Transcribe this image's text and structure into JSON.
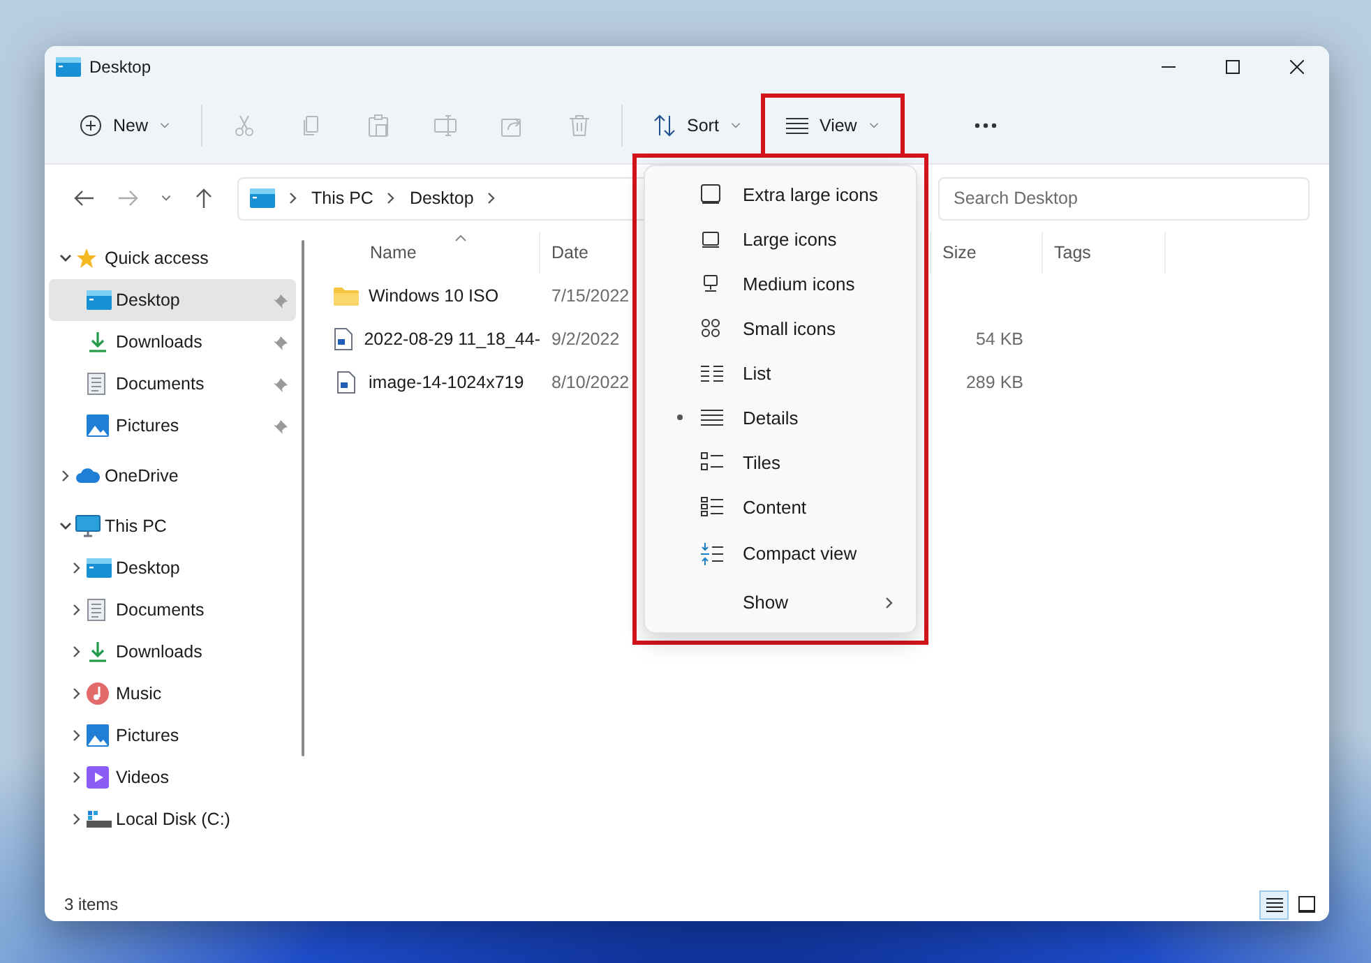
{
  "window": {
    "title": "Desktop"
  },
  "toolbar": {
    "items": [
      {
        "kind": "new",
        "label": "New",
        "disabled": false
      },
      {
        "kind": "cut",
        "disabled": true
      },
      {
        "kind": "copy",
        "disabled": true
      },
      {
        "kind": "paste",
        "disabled": true
      },
      {
        "kind": "rename",
        "disabled": true
      },
      {
        "kind": "share",
        "disabled": true
      },
      {
        "kind": "delete",
        "disabled": true
      },
      {
        "kind": "sort",
        "label": "Sort",
        "disabled": false
      },
      {
        "kind": "view",
        "label": "View",
        "disabled": false,
        "highlighted": true
      },
      {
        "kind": "more",
        "disabled": false
      }
    ]
  },
  "address": {
    "breadcrumbs": [
      "This PC",
      "Desktop"
    ]
  },
  "search": {
    "placeholder": "Search Desktop"
  },
  "nav": {
    "items": [
      {
        "label": "Quick access",
        "kind": "star",
        "expanded": true,
        "selected": false,
        "children": [
          {
            "label": "Desktop",
            "kind": "desktop",
            "selected": true,
            "pinned": true
          },
          {
            "label": "Downloads",
            "kind": "downloads",
            "selected": false,
            "pinned": true
          },
          {
            "label": "Documents",
            "kind": "documents",
            "selected": false,
            "pinned": true
          },
          {
            "label": "Pictures",
            "kind": "pictures",
            "selected": false,
            "pinned": true
          }
        ]
      },
      {
        "label": "OneDrive",
        "kind": "cloud",
        "expanded": false,
        "selected": false
      },
      {
        "label": "This PC",
        "kind": "pc",
        "expanded": true,
        "selected": false,
        "children": [
          {
            "label": "Desktop",
            "kind": "desktop",
            "expanded": false,
            "selected": false
          },
          {
            "label": "Documents",
            "kind": "documents",
            "expanded": false,
            "selected": false
          },
          {
            "label": "Downloads",
            "kind": "downloads",
            "expanded": false,
            "selected": false
          },
          {
            "label": "Music",
            "kind": "music",
            "expanded": false,
            "selected": false
          },
          {
            "label": "Pictures",
            "kind": "pictures",
            "expanded": false,
            "selected": false
          },
          {
            "label": "Videos",
            "kind": "videos",
            "expanded": false,
            "selected": false
          },
          {
            "label": "Local Disk (C:)",
            "kind": "drive",
            "expanded": false,
            "selected": false
          }
        ]
      }
    ]
  },
  "file_list": {
    "columns": [
      {
        "label": "Name",
        "sorted": true
      },
      {
        "label": "Date"
      },
      {
        "label": "Size"
      },
      {
        "label": "Tags"
      }
    ],
    "rows": [
      {
        "name": "Windows 10 ISO",
        "kind": "folder",
        "date": "7/15/2022"
      },
      {
        "name": "2022-08-29 11_18_44-",
        "kind": "image",
        "date": "9/2/2022",
        "size": "54 KB"
      },
      {
        "name": "image-14-1024x719",
        "kind": "image",
        "date": "8/10/2022",
        "size": "289 KB"
      }
    ]
  },
  "view_menu": {
    "highlighted": true,
    "items": [
      {
        "label": "Extra large icons",
        "selected": false,
        "submenu": false
      },
      {
        "label": "Large icons",
        "selected": false,
        "submenu": false
      },
      {
        "label": "Medium icons",
        "selected": false,
        "submenu": false
      },
      {
        "label": "Small icons",
        "selected": false,
        "submenu": false
      },
      {
        "label": "List",
        "selected": false,
        "submenu": false
      },
      {
        "label": "Details",
        "selected": true,
        "submenu": false
      },
      {
        "label": "Tiles",
        "selected": false,
        "submenu": false
      },
      {
        "label": "Content",
        "selected": false,
        "submenu": false
      },
      {
        "label": "Compact view",
        "selected": false,
        "submenu": false
      },
      {
        "label": "Show",
        "selected": false,
        "submenu": true
      }
    ]
  },
  "status_bar": {
    "text": "3 items",
    "view_toggles": [
      {
        "kind": "details",
        "selected": true
      },
      {
        "kind": "tiles",
        "selected": false
      }
    ]
  }
}
